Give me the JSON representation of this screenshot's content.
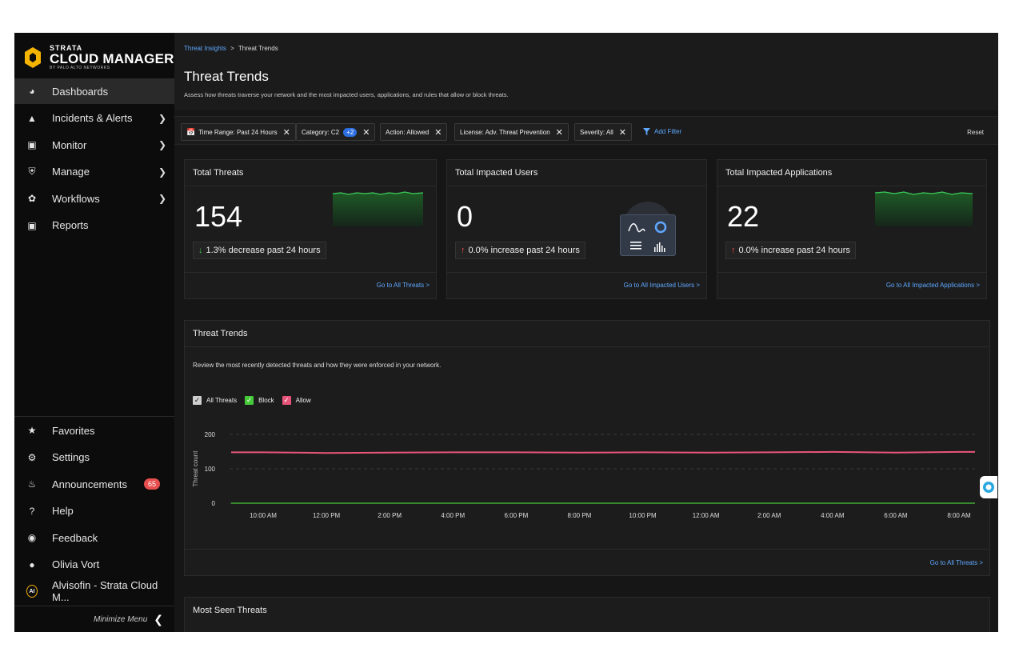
{
  "brand": {
    "top": "STRATA",
    "main": "CLOUD MANAGER",
    "by": "BY PALO ALTO NETWORKS"
  },
  "colors": {
    "accent": "#5fa8ff",
    "allow": "#e8557a",
    "block": "#46c93a",
    "all": "#cfcfcf",
    "badge": "#e84e4e"
  },
  "sidebar": {
    "items": [
      {
        "label": "Dashboards",
        "icon": "dashboard-icon",
        "active": true
      },
      {
        "label": "Incidents & Alerts",
        "icon": "alert-icon",
        "chevron": true
      },
      {
        "label": "Monitor",
        "icon": "monitor-icon",
        "chevron": true
      },
      {
        "label": "Manage",
        "icon": "shield-icon",
        "chevron": true
      },
      {
        "label": "Workflows",
        "icon": "workflows-icon",
        "chevron": true
      },
      {
        "label": "Reports",
        "icon": "reports-icon"
      }
    ],
    "bottom": [
      {
        "label": "Favorites",
        "icon": "star-icon"
      },
      {
        "label": "Settings",
        "icon": "gear-icon"
      },
      {
        "label": "Announcements",
        "icon": "bell-icon",
        "badge": "65"
      },
      {
        "label": "Help",
        "icon": "help-icon"
      },
      {
        "label": "Feedback",
        "icon": "feedback-icon"
      },
      {
        "label": "Olivia Vort",
        "icon": "user-icon"
      },
      {
        "label": "Alvisofin - Strata Cloud M...",
        "icon": "ai-icon",
        "icon_text": "AI"
      }
    ],
    "minimize": "Minimize Menu"
  },
  "breadcrumb": {
    "parent": "Threat Insights",
    "sep": ">",
    "current": "Threat Trends"
  },
  "page": {
    "title": "Threat Trends",
    "subtitle": "Assess how threats traverse your network and the most impacted users, applications, and rules that allow or block threats."
  },
  "filters": {
    "time": "Time Range: Past 24 Hours",
    "category": "Category: C2",
    "category_more": "+2",
    "action": "Action: Allowed",
    "license": "License: Adv. Threat Prevention",
    "severity": "Severity: All",
    "add": "Add Filter",
    "reset": "Reset"
  },
  "cards": [
    {
      "title": "Total Threats",
      "value": "154",
      "trend": "1.3% decrease past 24 hours",
      "direction": "down",
      "link": "Go to All Threats >"
    },
    {
      "title": "Total Impacted Users",
      "value": "0",
      "trend": "0.0% increase past 24 hours",
      "direction": "up",
      "link": "Go to All Impacted Users >"
    },
    {
      "title": "Total Impacted Applications",
      "value": "22",
      "trend": "0.0% increase past 24 hours",
      "direction": "up",
      "link": "Go to All Impacted Applications >"
    }
  ],
  "trends": {
    "title": "Threat Trends",
    "description": "Review the most recently detected threats and how they were enforced in your network.",
    "legend": [
      "All Threats",
      "Block",
      "Allow"
    ],
    "link": "Go to All Threats >"
  },
  "chart_data": {
    "type": "line",
    "ylabel": "Threat count",
    "xlabel": "",
    "ylim": [
      0,
      200
    ],
    "yticks": [
      0,
      100,
      200
    ],
    "grid": true,
    "x": [
      "10:00 AM",
      "12:00 PM",
      "2:00 PM",
      "4:00 PM",
      "6:00 PM",
      "8:00 PM",
      "10:00 PM",
      "12:00 AM",
      "2:00 AM",
      "4:00 AM",
      "6:00 AM",
      "8:00 AM"
    ],
    "series": [
      {
        "name": "Allow",
        "color": "#e8557a",
        "values": [
          148,
          146,
          147,
          148,
          148,
          147,
          148,
          147,
          148,
          149,
          147,
          149
        ]
      },
      {
        "name": "Block",
        "color": "#46c93a",
        "values": [
          0,
          0,
          0,
          0,
          0,
          0,
          0,
          0,
          0,
          0,
          0,
          0
        ]
      }
    ]
  },
  "most_seen": {
    "title": "Most Seen Threats"
  }
}
